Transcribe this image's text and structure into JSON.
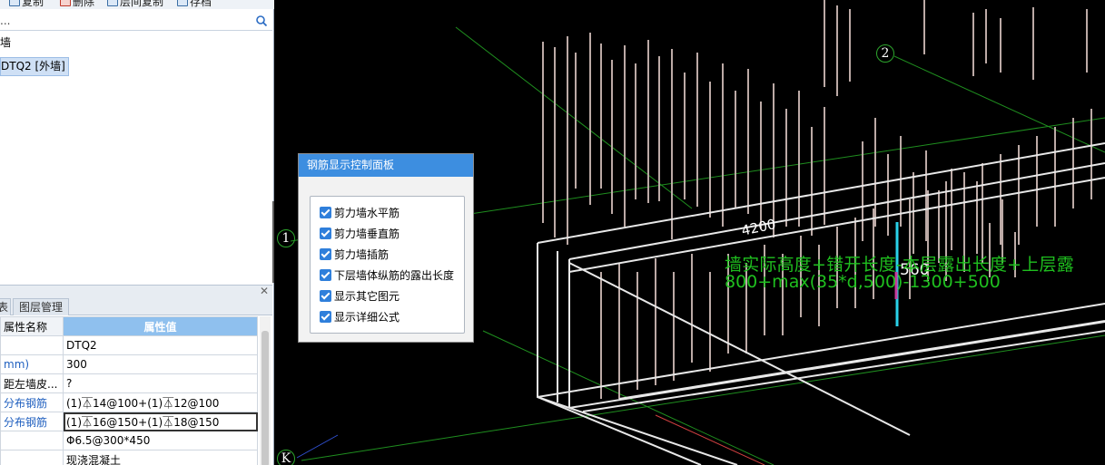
{
  "toolbar": {
    "items": [
      {
        "label": "复制",
        "icon": "copy-icon"
      },
      {
        "label": "删除",
        "icon": "delete-icon"
      },
      {
        "label": "层间复制",
        "icon": "layer-copy-icon"
      },
      {
        "label": "存档",
        "icon": "save-icon"
      }
    ]
  },
  "search": {
    "value": "..."
  },
  "tree": {
    "items": [
      {
        "label": "墙"
      },
      {
        "label": "DTQ2 [外墙]"
      }
    ]
  },
  "tabs": [
    {
      "label": "表"
    },
    {
      "label": "图层管理"
    }
  ],
  "properties": {
    "header": {
      "name": "属性名称",
      "value": "属性值"
    },
    "rows": [
      {
        "name": "",
        "value": "DTQ2"
      },
      {
        "name": "mm)",
        "value": "300"
      },
      {
        "name": "距左墙皮...",
        "value": "?"
      },
      {
        "name": "分布钢筋",
        "value": "(1)⏄14@100+(1)⏄12@100"
      },
      {
        "name": "分布钢筋",
        "value": "(1)⏄16@150+(1)⏄18@150"
      },
      {
        "name": "",
        "value": "Φ6.5@300*450"
      },
      {
        "name": "",
        "value": "现浇混凝土"
      }
    ]
  },
  "viewport": {
    "axis_labels": [
      "2",
      "1",
      "K"
    ],
    "dimension_4200": "4200",
    "dimension_560": "560",
    "formula_line1": "墙实际高度+错开长度-本层露出长度+上层露",
    "formula_line2": "800+max(35*d,500)-1300+500"
  },
  "dialog": {
    "title": "钢筋显示控制面板",
    "options": [
      {
        "label": "剪力墙水平筋",
        "checked": true
      },
      {
        "label": "剪力墙垂直筋",
        "checked": true
      },
      {
        "label": "剪力墙插筋",
        "checked": true
      },
      {
        "label": "下层墙体纵筋的露出长度",
        "checked": true
      },
      {
        "label": "显示其它图元",
        "checked": true
      },
      {
        "label": "显示详细公式",
        "checked": true
      }
    ]
  },
  "colors": {
    "selection": "#cfe0f5",
    "header_value": "#8fc0ee",
    "dialog_title": "#3d8ee0",
    "formula": "#1fbf1f",
    "axis": "#2da52d"
  }
}
